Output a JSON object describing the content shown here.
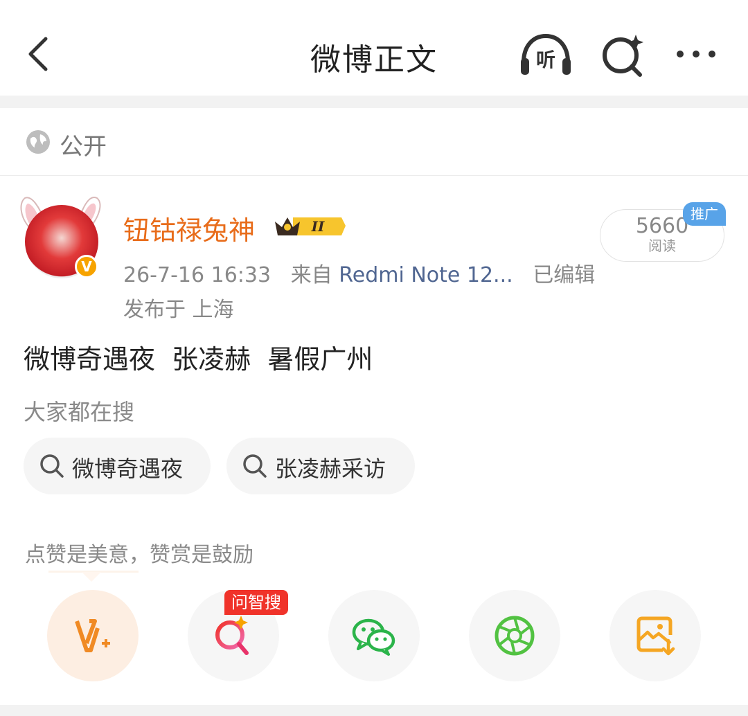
{
  "header": {
    "title": "微博正文",
    "listen_icon_text": "听",
    "icons": [
      "back-icon",
      "listen-icon",
      "ai-search-icon",
      "more-icon"
    ]
  },
  "visibility": {
    "label": "公开"
  },
  "author": {
    "name": "钮钴禄兔神",
    "level_badge": "II",
    "verified_mark": "V"
  },
  "post_meta": {
    "time": "26-7-16 16:33",
    "from_label": "来自",
    "device": "Redmi Note 12...",
    "edited": "已编辑",
    "location": "发布于 上海"
  },
  "read_stats": {
    "count": "5660",
    "label": "阅读",
    "promo": "推广"
  },
  "post": {
    "text": "微博奇遇夜  张凌赫  暑假广州"
  },
  "related_search": {
    "label": "大家都在搜",
    "chips": [
      {
        "text": "微博奇遇夜"
      },
      {
        "text": "张凌赫采访"
      }
    ]
  },
  "actions": {
    "encourage_text": "点赞是美意，赞赏是鼓励",
    "ai_badge": "问智搜",
    "items": [
      "reward-icon",
      "ai-search-icon",
      "wechat-icon",
      "moments-icon",
      "save-image-icon"
    ]
  },
  "colors": {
    "author_name": "#e86c1a",
    "device_link": "#506691",
    "promo_tag": "#58a3e8",
    "ai_badge": "#f0332a",
    "wechat": "#2bb44a",
    "save_image": "#f5a623"
  }
}
